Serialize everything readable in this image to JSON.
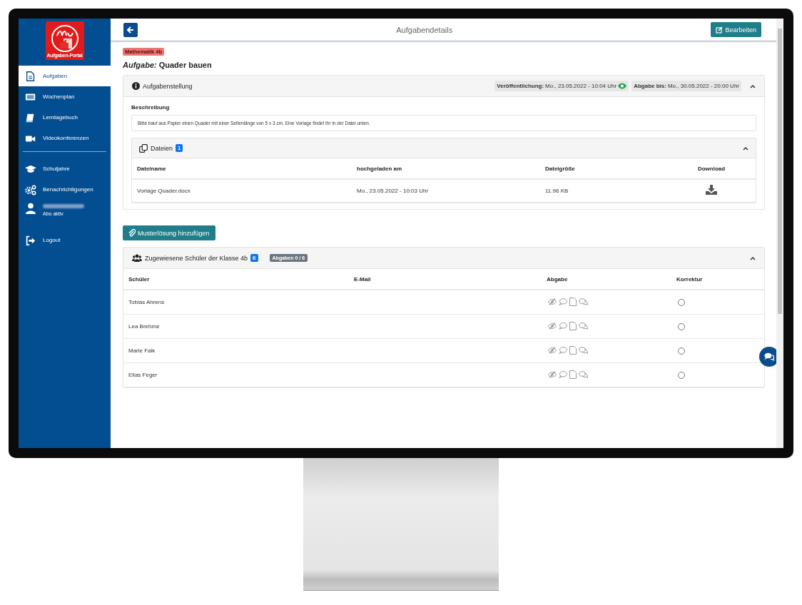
{
  "sidebar": {
    "logo": {
      "caption": "Aufgaben-Portal"
    },
    "items": [
      {
        "kind": "link",
        "label": "Aufgaben",
        "selected": true
      },
      {
        "kind": "link",
        "label": "Wochenplan",
        "selected": false
      },
      {
        "kind": "link",
        "label": "Lerntagebuch",
        "selected": false
      },
      {
        "kind": "link",
        "label": "Videokonferenzen",
        "selected": false
      },
      {
        "kind": "divider"
      },
      {
        "kind": "link",
        "label": "Schuljahre",
        "selected": false
      },
      {
        "kind": "link",
        "label": "Benachrichtigungen",
        "selected": false
      },
      {
        "kind": "account",
        "subtitle": "Abo aktiv"
      },
      {
        "kind": "link",
        "label": "Logout",
        "selected": false
      }
    ]
  },
  "header": {
    "title": "Aufgabendetails",
    "edit_button": "Bearbeiten"
  },
  "tag": "Mathematik 4b",
  "task_heading": "*Aufgabe:* Quader bauen",
  "task_panel": {
    "title": "Aufgabenstellung",
    "expanded": true,
    "published": {
      "label": "Veröffentlichung:",
      "value": "Mo., 23.05.2022 - 10:04 Uhr",
      "visible": true
    },
    "due": {
      "label": "Abgabe bis:",
      "value": "Mo., 30.05.2022 - 20:00 Uhr"
    },
    "description_label": "Beschreibung",
    "description": "Bitte baut aus Papier einen Quader mit einer Seitenlänge von 5 x 3 cm. Eine Vorlage findet Ihr in der Datei unten.",
    "files": {
      "title": "Dateien",
      "count": "1",
      "expanded": true,
      "columns": [
        "Dateiname",
        "hochgeladen am",
        "Dateigröße",
        "Download"
      ],
      "rows": [
        {
          "name": "Vorlage Quader.docx",
          "uploaded": "Mo., 23.05.2022 - 10:03 Uhr",
          "size": "11.96 KB"
        }
      ]
    }
  },
  "solution_button": "Musterlösung hinzufügen",
  "students_panel": {
    "title": "Zugewiesene Schüler der Klasse 4b",
    "count": "6",
    "submissions": "Abgaben 0 / 6",
    "expanded": true,
    "columns": [
      "Schüler",
      "E-Mail",
      "Abgabe",
      "Korrektur"
    ],
    "rows": [
      {
        "name": "Tobias Ahrens",
        "corrected": false
      },
      {
        "name": "Lea Brehme",
        "corrected": false
      },
      {
        "name": "Marie Falk",
        "corrected": false
      },
      {
        "name": "Elias Feger",
        "corrected": false
      }
    ]
  }
}
